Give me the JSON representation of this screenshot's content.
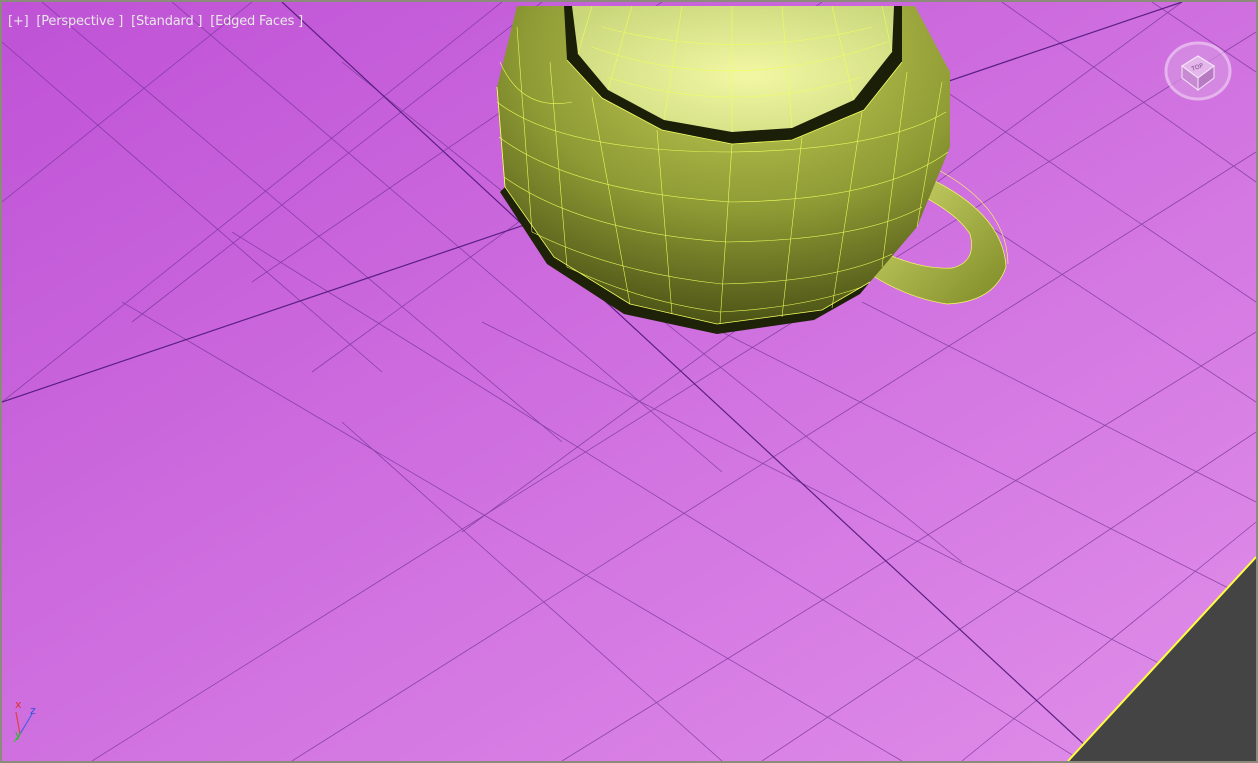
{
  "viewport": {
    "labels": {
      "menu": "[+]",
      "view": "[Perspective ]",
      "shading": "[Standard ]",
      "display": "[Edged Faces ]"
    },
    "background_colors": {
      "floor_top": "#c25bd8",
      "floor_bottom": "#de8ae8",
      "outside": "#444444"
    },
    "grid_color": "#6a2f90",
    "selection_edge_color": "#ffff40",
    "viewcube": {
      "face_label": "TOP",
      "icon": "viewcube-icon"
    },
    "axis_tripod": {
      "x": "x",
      "y": "y",
      "z": "z"
    },
    "object": {
      "name": "cup",
      "color": "#c9d94e",
      "wire_color": "#f4ff60"
    }
  }
}
